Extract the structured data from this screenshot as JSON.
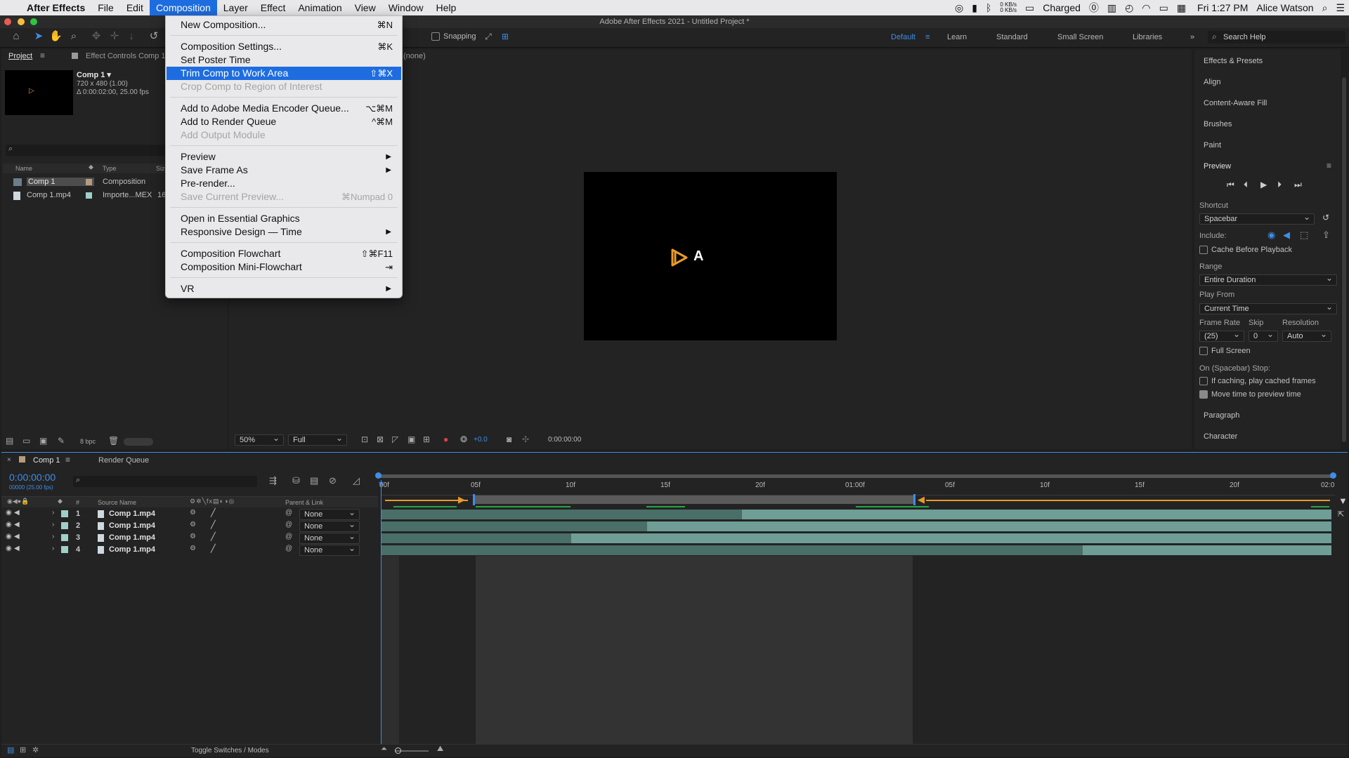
{
  "menubar": {
    "app": "After Effects",
    "items": [
      "File",
      "Edit",
      "Composition",
      "Layer",
      "Effect",
      "Animation",
      "View",
      "Window",
      "Help"
    ],
    "net_up": "0 KB/s",
    "net_down": "0 KB/s",
    "battery": "Charged",
    "clock": "Fri 1:27 PM",
    "user": "Alice Watson"
  },
  "window": {
    "title": "Adobe After Effects 2021 - Untitled Project *"
  },
  "toolbar": {
    "snapping": "Snapping",
    "workspaces": [
      "Default",
      "Learn",
      "Standard",
      "Small Screen",
      "Libraries"
    ],
    "search_placeholder": "Search Help"
  },
  "project": {
    "tab": "Project",
    "effect_controls": "Effect Controls Comp 1",
    "comp_name": "Comp 1 ▾",
    "comp_size": "720 x 480 (1.00)",
    "comp_duration": "Δ 0:00:02:00, 25.00 fps",
    "columns": [
      "Name",
      "Type",
      "Size"
    ],
    "items": [
      {
        "name": "Comp 1",
        "type": "Composition",
        "size": ""
      },
      {
        "name": "Comp 1.mp4",
        "type": "Importe...MEX",
        "size": "16"
      }
    ],
    "bpc": "8 bpc"
  },
  "composition_menu": {
    "items": [
      {
        "label": "New Composition...",
        "shortcut": "⌘N"
      },
      {
        "label": "Composition Settings...",
        "shortcut": "⌘K"
      },
      {
        "label": "Set Poster Time",
        "shortcut": ""
      },
      {
        "label": "Trim Comp to Work Area",
        "shortcut": "⇧⌘X"
      },
      {
        "label": "Crop Comp to Region of Interest",
        "shortcut": ""
      },
      {
        "label": "Add to Adobe Media Encoder Queue...",
        "shortcut": "⌥⌘M"
      },
      {
        "label": "Add to Render Queue",
        "shortcut": "^⌘M"
      },
      {
        "label": "Add Output Module",
        "shortcut": ""
      },
      {
        "label": "Preview",
        "shortcut": ""
      },
      {
        "label": "Save Frame As",
        "shortcut": ""
      },
      {
        "label": "Pre-render...",
        "shortcut": ""
      },
      {
        "label": "Save Current Preview...",
        "shortcut": "⌘Numpad 0"
      },
      {
        "label": "Open in Essential Graphics",
        "shortcut": ""
      },
      {
        "label": "Responsive Design — Time",
        "shortcut": ""
      },
      {
        "label": "Composition Flowchart",
        "shortcut": "⇧⌘F11"
      },
      {
        "label": "Composition Mini-Flowchart",
        "shortcut": "⇥"
      },
      {
        "label": "VR",
        "shortcut": ""
      }
    ]
  },
  "viewer": {
    "layer_label": "(none)",
    "logo_text": "A",
    "zoom": "50%",
    "resolution": "Full",
    "exposure": "+0.0",
    "timecode": "0:00:00:00"
  },
  "right_panel": {
    "sections": [
      "Effects & Presets",
      "Align",
      "Content-Aware Fill",
      "Brushes",
      "Paint",
      "Preview",
      "Paragraph",
      "Character"
    ],
    "shortcut_label": "Shortcut",
    "shortcut_value": "Spacebar",
    "include_label": "Include:",
    "cache_label": "Cache Before Playback",
    "range_label": "Range",
    "range_value": "Entire Duration",
    "play_from_label": "Play From",
    "play_from_value": "Current Time",
    "frame_rate_label": "Frame Rate",
    "skip_label": "Skip",
    "resolution_label": "Resolution",
    "frame_rate_value": "(25)",
    "skip_value": "0",
    "resolution_value": "Auto",
    "full_screen_label": "Full Screen",
    "stop_label": "On (Spacebar) Stop:",
    "if_caching_label": "If caching, play cached frames",
    "move_time_label": "Move time to preview time"
  },
  "timeline": {
    "tab": "Comp 1",
    "render_queue": "Render Queue",
    "timecode": "0:00:00:00",
    "fps_note": "00000 (25.00 fps)",
    "col_num": "#",
    "col_source": "Source Name",
    "col_parent": "Parent & Link",
    "layers": [
      {
        "num": "1",
        "name": "Comp 1.mp4",
        "parent": "None"
      },
      {
        "num": "2",
        "name": "Comp 1.mp4",
        "parent": "None"
      },
      {
        "num": "3",
        "name": "Comp 1.mp4",
        "parent": "None"
      },
      {
        "num": "4",
        "name": "Comp 1.mp4",
        "parent": "None"
      }
    ],
    "ruler": [
      "00f",
      "05f",
      "10f",
      "15f",
      "20f",
      "01:00f",
      "05f",
      "10f",
      "15f",
      "20f",
      "02:0"
    ],
    "toggle_label": "Toggle Switches / Modes"
  }
}
